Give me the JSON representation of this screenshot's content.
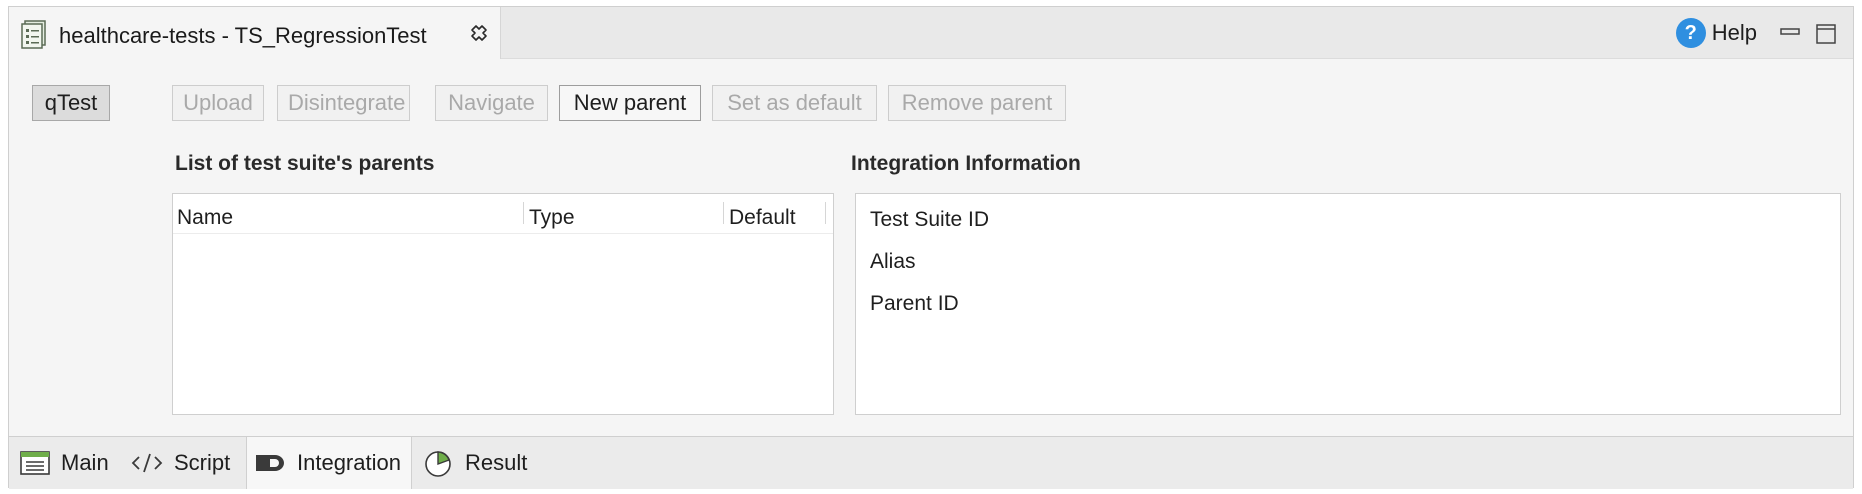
{
  "editor": {
    "tab_title": "healthcare-tests - TS_RegressionTest",
    "help_label": "Help"
  },
  "toolbar": {
    "qtest_label": "qTest",
    "upload_label": "Upload",
    "disintegrate_label": "Disintegrate",
    "navigate_label": "Navigate",
    "new_parent_label": "New parent",
    "set_default_label": "Set as default",
    "remove_parent_label": "Remove parent"
  },
  "parents": {
    "title": "List of test suite's parents",
    "columns": [
      "Name",
      "Type",
      "Default"
    ],
    "rows": []
  },
  "integration_info": {
    "title": "Integration Information",
    "fields": [
      "Test Suite ID",
      "Alias",
      "Parent ID"
    ]
  },
  "bottom_tabs": [
    {
      "label": "Main",
      "icon": "list-icon"
    },
    {
      "label": "Script",
      "icon": "code-icon"
    },
    {
      "label": "Integration",
      "icon": "integration-icon",
      "active": true
    },
    {
      "label": "Result",
      "icon": "pie-chart-icon"
    }
  ],
  "colors": {
    "accent": "#2f8fe0",
    "disabled_text": "#a9a9a9"
  }
}
